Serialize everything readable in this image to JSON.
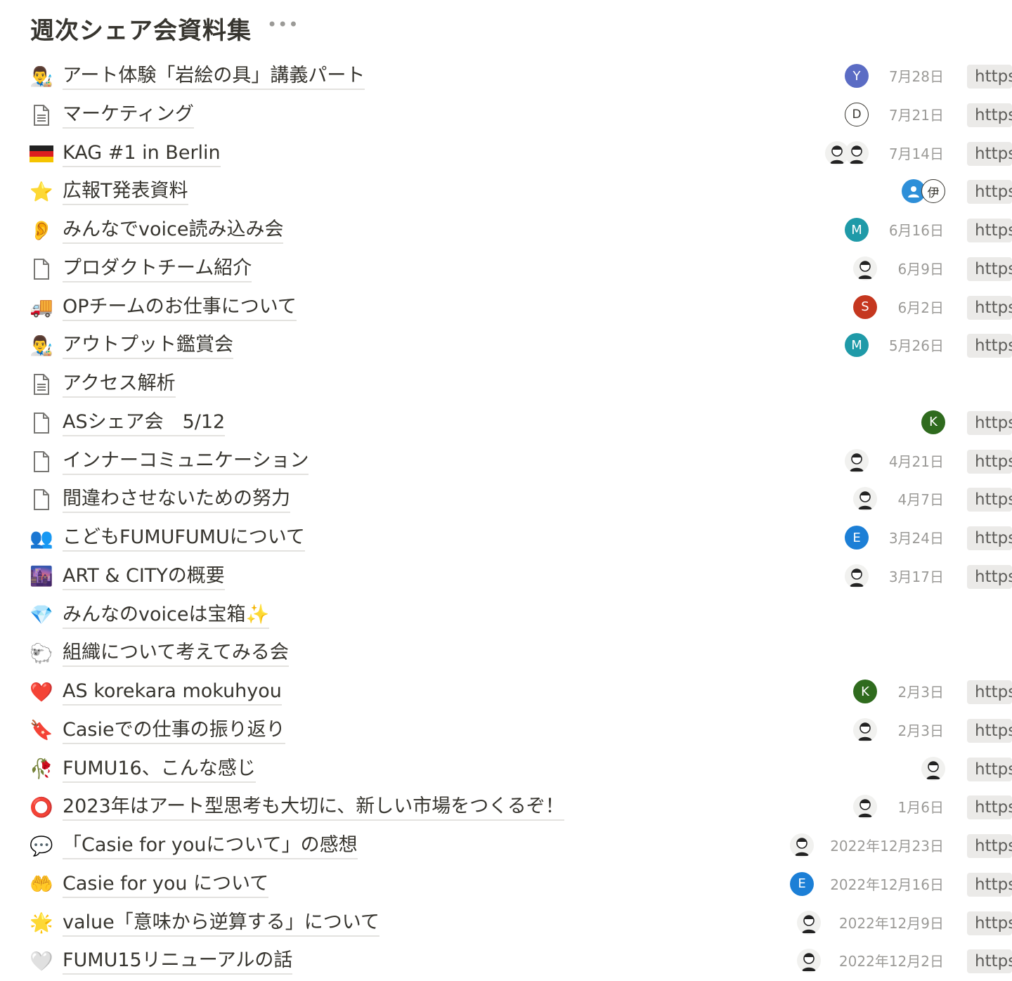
{
  "page": {
    "title": "週次シェア会資料集",
    "more_label": "•••"
  },
  "rows": [
    {
      "icon": "painter-emoji",
      "glyph": "👨‍🎨",
      "title": "アート体験「岩絵の具」講義パート",
      "avatars": [
        {
          "type": "letter",
          "letter": "Y",
          "color": "#5b6cc4"
        }
      ],
      "date": "7月28日",
      "url": "https"
    },
    {
      "icon": "document-icon",
      "glyph": "",
      "title": "マーケティング",
      "avatars": [
        {
          "type": "outline",
          "letter": "D"
        }
      ],
      "date": "7月21日",
      "url": "https"
    },
    {
      "icon": "germany-flag-emoji",
      "glyph": "",
      "title": "KAG #1 in Berlin",
      "avatars": [
        {
          "type": "photo",
          "letter": ""
        },
        {
          "type": "photo",
          "letter": ""
        }
      ],
      "date": "7月14日",
      "url": "https"
    },
    {
      "icon": "star-emoji",
      "glyph": "⭐",
      "title": "広報T発表資料",
      "avatars": [
        {
          "type": "letter",
          "letter": "",
          "color": "#2e8fd8"
        },
        {
          "type": "outline",
          "letter": "伊"
        }
      ],
      "date": "",
      "url": "https"
    },
    {
      "icon": "ear-emoji",
      "glyph": "👂",
      "title": "みんなでvoice読み込み会",
      "avatars": [
        {
          "type": "letter",
          "letter": "M",
          "color": "#1f9aa8"
        }
      ],
      "date": "6月16日",
      "url": "https"
    },
    {
      "icon": "page-icon",
      "glyph": "",
      "title": "プロダクトチーム紹介",
      "avatars": [
        {
          "type": "photo",
          "letter": ""
        }
      ],
      "date": "6月9日",
      "url": "https"
    },
    {
      "icon": "truck-emoji",
      "glyph": "🚚",
      "title": "OPチームのお仕事について",
      "avatars": [
        {
          "type": "letter",
          "letter": "S",
          "color": "#c5371f"
        }
      ],
      "date": "6月2日",
      "url": "https"
    },
    {
      "icon": "painter-emoji",
      "glyph": "👨‍🎨",
      "title": "アウトプット鑑賞会",
      "avatars": [
        {
          "type": "letter",
          "letter": "M",
          "color": "#1f9aa8"
        }
      ],
      "date": "5月26日",
      "url": "https"
    },
    {
      "icon": "document-icon",
      "glyph": "",
      "title": "アクセス解析",
      "avatars": [],
      "date": "",
      "url": ""
    },
    {
      "icon": "page-icon",
      "glyph": "",
      "title": "ASシェア会　5/12",
      "avatars": [
        {
          "type": "letter",
          "letter": "K",
          "color": "#2f6b1e"
        }
      ],
      "date": "",
      "url": "https"
    },
    {
      "icon": "page-icon",
      "glyph": "",
      "title": "インナーコミュニケーション",
      "avatars": [
        {
          "type": "photo",
          "letter": ""
        }
      ],
      "date": "4月21日",
      "url": "https"
    },
    {
      "icon": "page-icon",
      "glyph": "",
      "title": "間違わさせないための努力",
      "avatars": [
        {
          "type": "photo",
          "letter": ""
        }
      ],
      "date": "4月7日",
      "url": "https"
    },
    {
      "icon": "people-emoji",
      "glyph": "👥",
      "title": "こどもFUMUFUMUについて",
      "avatars": [
        {
          "type": "letter",
          "letter": "E",
          "color": "#1c7fd6"
        }
      ],
      "date": "3月24日",
      "url": "https"
    },
    {
      "icon": "city-emoji",
      "glyph": "🌆",
      "title": "ART & CITYの概要",
      "avatars": [
        {
          "type": "photo",
          "letter": ""
        }
      ],
      "date": "3月17日",
      "url": "https"
    },
    {
      "icon": "gem-emoji",
      "glyph": "💎",
      "title": "みんなのvoiceは宝箱✨",
      "avatars": [],
      "date": "",
      "url": ""
    },
    {
      "icon": "sheep-emoji",
      "glyph": "🐑",
      "title": "組織について考えてみる会",
      "avatars": [],
      "date": "",
      "url": ""
    },
    {
      "icon": "heart-emoji",
      "glyph": "❤️",
      "title": "AS korekara mokuhyou",
      "avatars": [
        {
          "type": "letter",
          "letter": "K",
          "color": "#2f6b1e"
        }
      ],
      "date": "2月3日",
      "url": "https"
    },
    {
      "icon": "bookmark-emoji",
      "glyph": "🔖",
      "title": "Casieでの仕事の振り返り",
      "avatars": [
        {
          "type": "photo",
          "letter": ""
        }
      ],
      "date": "2月3日",
      "url": "https"
    },
    {
      "icon": "tulip-emoji",
      "glyph": "🥀",
      "title": "FUMU16、こんな感じ",
      "avatars": [
        {
          "type": "photo",
          "letter": ""
        }
      ],
      "date": "",
      "url": "https"
    },
    {
      "icon": "red-circle-button-emoji",
      "glyph": "⭕",
      "title": "2023年はアート型思考も大切に、新しい市場をつくるぞ！",
      "avatars": [
        {
          "type": "photo",
          "letter": ""
        }
      ],
      "date": "1月6日",
      "url": "https"
    },
    {
      "icon": "speech-bubble-emoji",
      "glyph": "💬",
      "title": "「Casie for youについて」の感想",
      "avatars": [
        {
          "type": "photo",
          "letter": ""
        }
      ],
      "date": "2022年12月23日",
      "url": "https"
    },
    {
      "icon": "open-hands-emoji",
      "glyph": "🤲",
      "title": "Casie for you について",
      "avatars": [
        {
          "type": "letter",
          "letter": "E",
          "color": "#1c7fd6"
        }
      ],
      "date": "2022年12月16日",
      "url": "https"
    },
    {
      "icon": "glowing-star-emoji",
      "glyph": "🌟",
      "title": "value「意味から逆算する」について",
      "avatars": [
        {
          "type": "photo",
          "letter": ""
        }
      ],
      "date": "2022年12月9日",
      "url": "https"
    },
    {
      "icon": "white-heart-emoji",
      "glyph": "🤍",
      "title": "FUMU15リニューアルの話",
      "avatars": [
        {
          "type": "photo",
          "letter": ""
        }
      ],
      "date": "2022年12月2日",
      "url": "https"
    }
  ]
}
